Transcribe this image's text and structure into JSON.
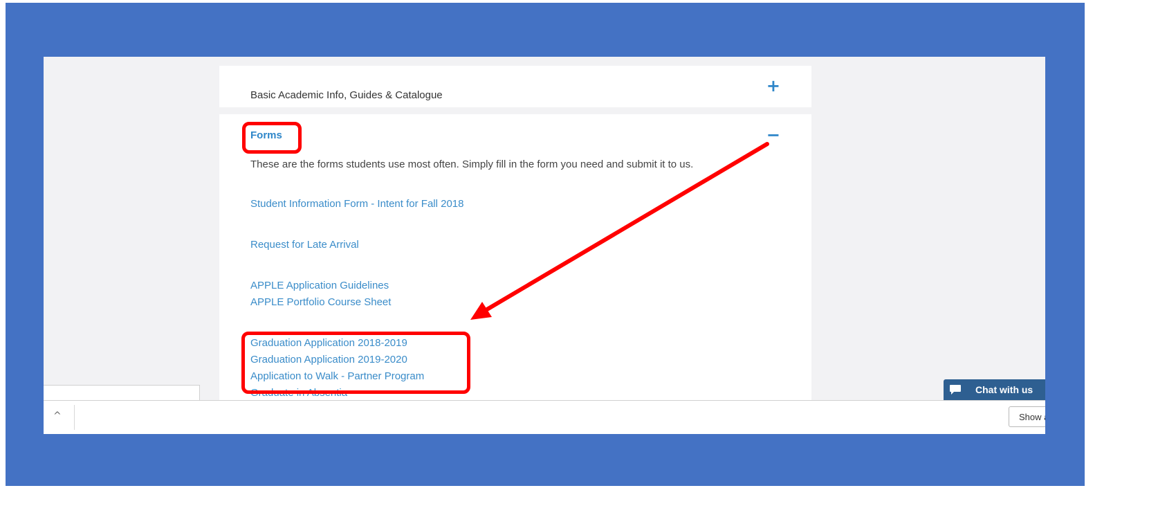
{
  "accordion": {
    "basic": {
      "title": "Basic Academic Info, Guides & Catalogue",
      "toggle": "+"
    },
    "forms": {
      "title": "Forms",
      "toggle": "−",
      "description": "These are the forms students use most often. Simply fill in the form you need and submit it to us.",
      "links": [
        "Student Information Form - Intent for Fall 2018",
        "Request for Late Arrival",
        "APPLE Application Guidelines",
        "APPLE Portfolio Course Sheet",
        "Graduation Application 2018-2019",
        "Graduation Application 2019-2020",
        "Application to Walk - Partner Program",
        "Graduate in Absentia"
      ]
    }
  },
  "chat": {
    "label": "Chat with us"
  },
  "bottom_bar": {
    "caret": "^",
    "show_label": "Show all"
  },
  "colors": {
    "frame": "#4472c4",
    "link": "#3a8cc9",
    "annotation": "#ff0000",
    "chat": "#2e5f91"
  }
}
